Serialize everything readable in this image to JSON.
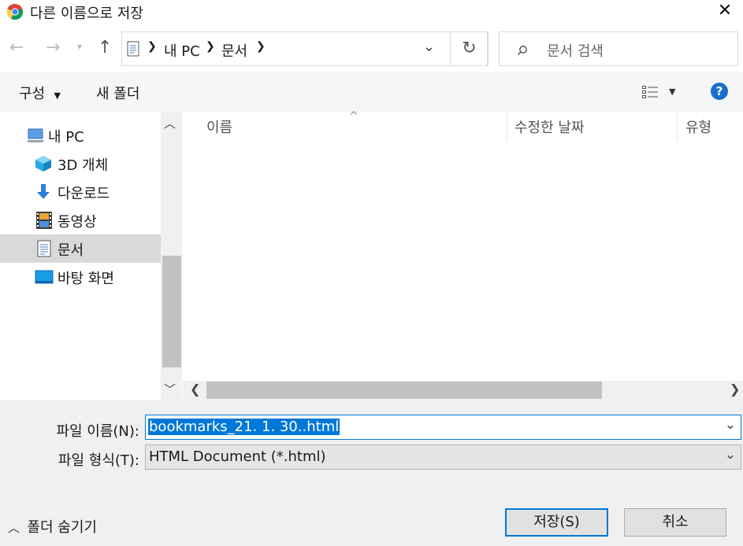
{
  "window": {
    "title": "다른 이름으로 저장",
    "close_symbol": "✕"
  },
  "nav": {
    "breadcrumb": [
      "내 PC",
      "문서"
    ],
    "search_placeholder": "문서 검색"
  },
  "toolbar": {
    "organize_label": "구성",
    "new_folder_label": "새 폴더",
    "help_symbol": "?"
  },
  "sidebar": {
    "items": [
      {
        "label": "내 PC",
        "icon": "computer-icon"
      },
      {
        "label": "3D 개체",
        "icon": "cube-icon"
      },
      {
        "label": "다운로드",
        "icon": "download-icon"
      },
      {
        "label": "동영상",
        "icon": "video-icon"
      },
      {
        "label": "문서",
        "icon": "document-icon",
        "selected": true
      },
      {
        "label": "바탕 화면",
        "icon": "desktop-icon"
      }
    ]
  },
  "file_list": {
    "columns": [
      "이름",
      "수정한 날짜",
      "유형"
    ]
  },
  "form": {
    "filename_label": "파일 이름(N):",
    "filename_value": "bookmarks_21. 1. 30..html",
    "filetype_label": "파일 형식(T):",
    "filetype_value": "HTML Document (*.html)"
  },
  "footer": {
    "hide_folders_label": "폴더 숨기기",
    "save_label": "저장(S)",
    "cancel_label": "취소"
  },
  "colors": {
    "accent": "#0078d7",
    "selection_bg": "#0078d7",
    "selected_nav_bg": "#d9d9d9"
  }
}
